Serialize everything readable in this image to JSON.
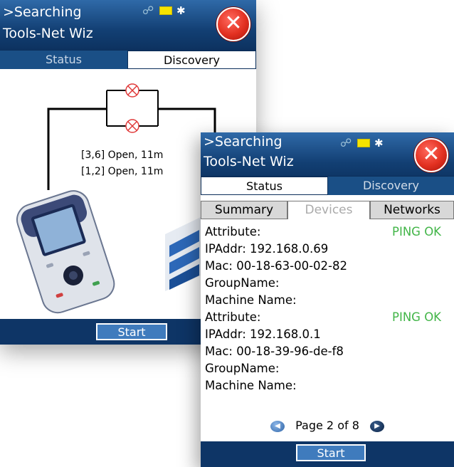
{
  "back": {
    "title_line1": ">Searching",
    "title_line2": "Tools-Net Wiz",
    "tabs": [
      "Status",
      "Discovery"
    ],
    "wire_labels": [
      "[3,6] Open, 11m",
      "[1,2] Open, 11m"
    ],
    "start_label": "Start",
    "icons": [
      "network-icon",
      "battery-icon",
      "bluetooth-icon",
      "close-icon"
    ]
  },
  "front": {
    "title_line1": ">Searching",
    "title_line2": "Tools-Net Wiz",
    "tabs": [
      "Status",
      "Discovery"
    ],
    "subtabs": [
      "Summary",
      "Devices",
      "Networks"
    ],
    "rows": [
      {
        "text": "Attribute:",
        "status": "PING OK"
      },
      {
        "text": "IPAddr:  192.168.0.69"
      },
      {
        "text": "Mac:  00-18-63-00-02-82"
      },
      {
        "text": "GroupName:"
      },
      {
        "text": "Machine Name:"
      },
      {
        "text": "Attribute:",
        "status": "PING OK"
      },
      {
        "text": "IPAddr:  192.168.0.1"
      },
      {
        "text": "Mac:  00-18-39-96-de-f8"
      },
      {
        "text": "GroupName:"
      },
      {
        "text": "Machine Name:"
      }
    ],
    "pager": "Page 2 of 8",
    "start_label": "Start"
  },
  "colors": {
    "titlebar": "#123f73",
    "ping_ok": "#42b548",
    "close": "#e23020"
  }
}
